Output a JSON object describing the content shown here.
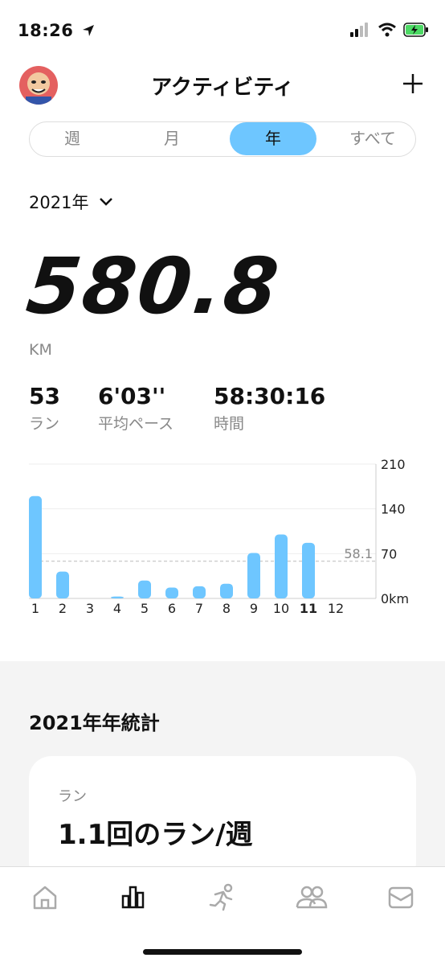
{
  "status": {
    "time": "18:26"
  },
  "header": {
    "title": "アクティビティ"
  },
  "tabs": [
    {
      "label": "週"
    },
    {
      "label": "月"
    },
    {
      "label": "年"
    },
    {
      "label": "すべて"
    }
  ],
  "active_tab": 2,
  "year_selector": {
    "label": "2021年"
  },
  "summary": {
    "distance": "580.8",
    "unit": "KM",
    "runs_value": "53",
    "runs_label": "ラン",
    "pace_value": "6'03''",
    "pace_label": "平均ペース",
    "time_value": "58:30:16",
    "time_label": "時間"
  },
  "chart_data": {
    "type": "bar",
    "categories": [
      "1",
      "2",
      "3",
      "4",
      "5",
      "6",
      "7",
      "8",
      "9",
      "10",
      "11",
      "12"
    ],
    "values": [
      160,
      42,
      0,
      3,
      28,
      17,
      19,
      23,
      71,
      100,
      87,
      0
    ],
    "y_ticks": [
      "0km",
      "70",
      "140",
      "210"
    ],
    "ylim": [
      0,
      210
    ],
    "average": 58.1,
    "average_label": "58.1",
    "highlighted_category": "11",
    "bar_color": "#6ec6ff"
  },
  "stats_section": {
    "title": "2021年年統計",
    "card_label": "ラン",
    "card_value": "1.1回のラン/週"
  },
  "tabbar": {
    "icons": [
      "home-icon",
      "activity-chart-icon",
      "runner-icon",
      "friends-icon",
      "mail-icon"
    ],
    "active_index": 1
  }
}
